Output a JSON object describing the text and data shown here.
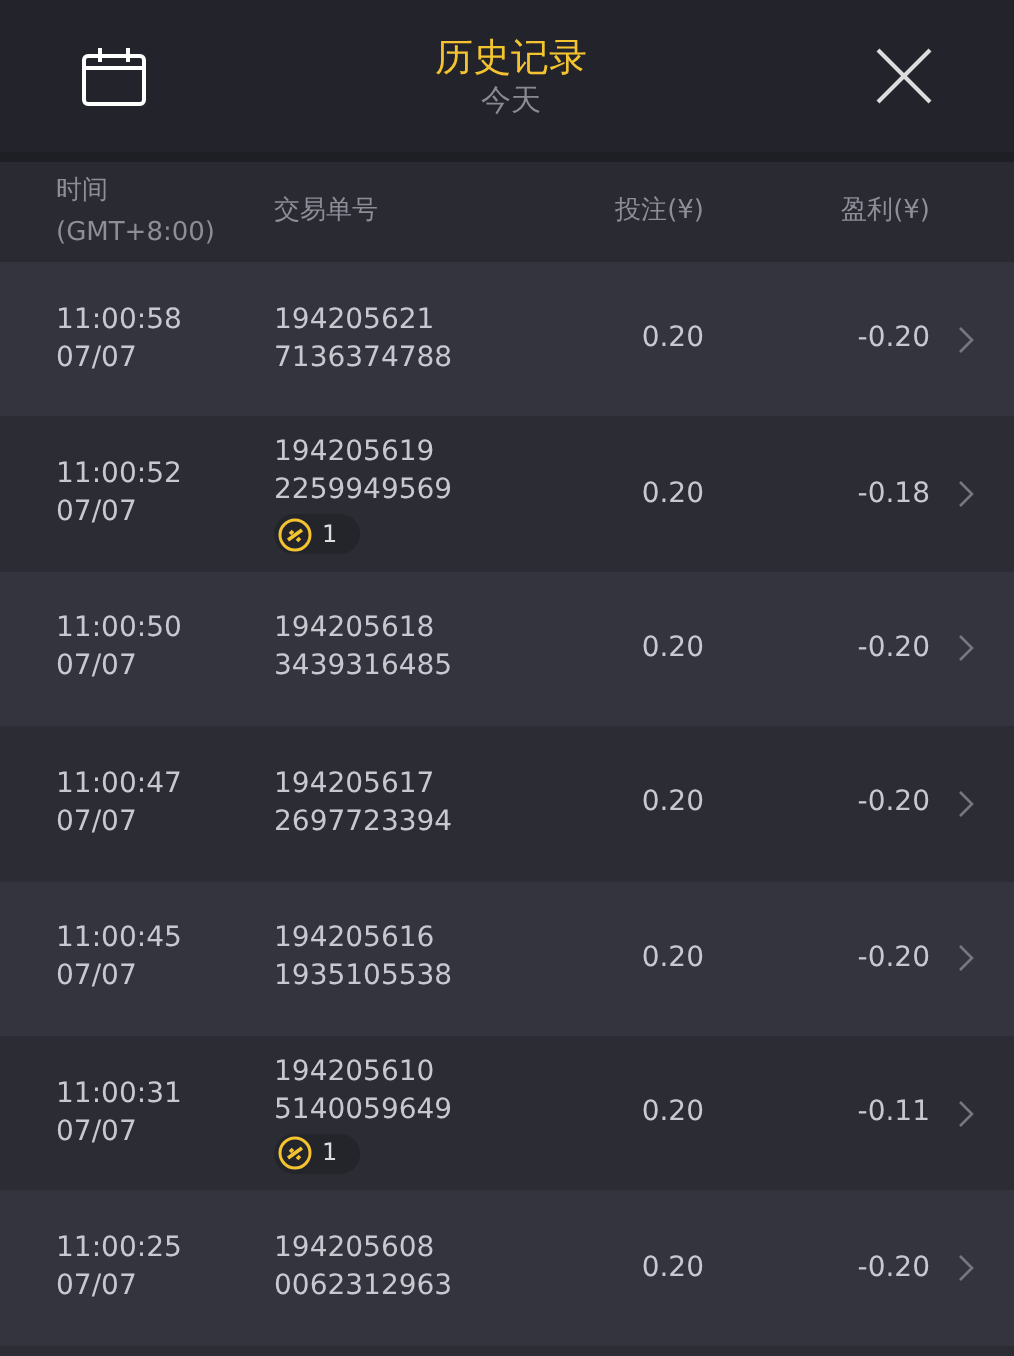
{
  "header": {
    "title": "历史记录",
    "subtitle": "今天"
  },
  "columns": [
    "时间\n(GMT+8:00)",
    "交易单号",
    "投注(¥)",
    "盈利(¥)"
  ],
  "rows": [
    {
      "time": "11:00:58",
      "date": "07/07",
      "id_1": "194205621",
      "id_2": "7136374788",
      "bet": "0.20",
      "profit": "-0.20"
    },
    {
      "time": "11:00:52",
      "date": "07/07",
      "id_1": "194205619",
      "id_2": "2259949569",
      "badge": "1",
      "bet": "0.20",
      "profit": "-0.18"
    },
    {
      "time": "11:00:50",
      "date": "07/07",
      "id_1": "194205618",
      "id_2": "3439316485",
      "bet": "0.20",
      "profit": "-0.20"
    },
    {
      "time": "11:00:47",
      "date": "07/07",
      "id_1": "194205617",
      "id_2": "2697723394",
      "bet": "0.20",
      "profit": "-0.20"
    },
    {
      "time": "11:00:45",
      "date": "07/07",
      "id_1": "194205616",
      "id_2": "1935105538",
      "bet": "0.20",
      "profit": "-0.20"
    },
    {
      "time": "11:00:31",
      "date": "07/07",
      "id_1": "194205610",
      "id_2": "5140059649",
      "badge": "1",
      "bet": "0.20",
      "profit": "-0.11"
    },
    {
      "time": "11:00:25",
      "date": "07/07",
      "id_1": "194205608",
      "id_2": "0062312963",
      "bet": "0.20",
      "profit": "-0.20"
    }
  ]
}
